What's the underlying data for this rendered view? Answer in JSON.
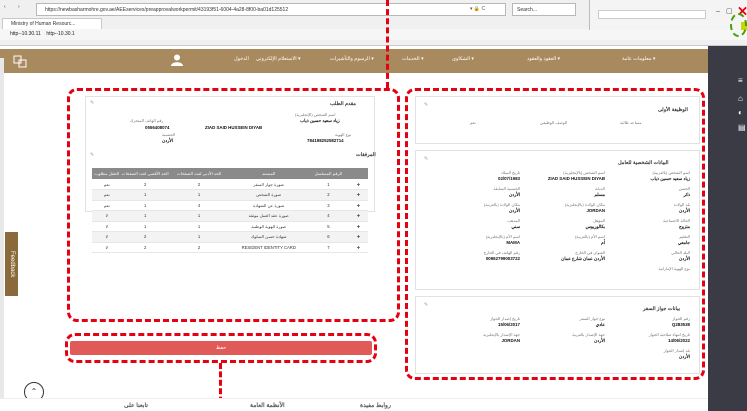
{
  "browser": {
    "url": "https://newbasharmohre.gov.ae/AEEservices/preapprovalworkpermit/43193f51-6004-4a28-8f00-ba01d125512",
    "lock_and_refresh": "▾ 🔒 C",
    "search_placeholder": "Search...",
    "tab_title": "Ministry of Human Resourc...",
    "favorites": [
      "http--10.30.11",
      "http--10.30.1"
    ]
  },
  "app": {
    "nav": [
      "معلومات عامة ▾",
      "العقود والعقود ▾",
      "الشكاوى ▾",
      "الخدمات ▾",
      "الرسوم والتأشيرات ▾",
      "الاستعلام الإلكتروني ▾",
      "الدخول"
    ]
  },
  "request_info": {
    "title": "مقدم الطلب",
    "name_label": "اسم الشخص (الإنجليزية)",
    "name_ar": "زياد سعيد حسين ذياب",
    "name_en": "ZIAD SAID HUSSEIN DIYAB",
    "phone_label": "رقم الهاتف المتحرك",
    "phone": "0556408074",
    "nationality_label": "الجنسية",
    "nationality": "الأردن",
    "id_type_label": "نوع الهوية",
    "id_number": "784198252582714"
  },
  "attachments": {
    "title": "المرفقات",
    "headers": [
      "الرقم المسلسل",
      "المستند",
      "الحد الأدنى لعدد الصفحات",
      "الحد الأقصى لعدد الصفحات",
      "الحقل مطلوب"
    ],
    "rows": [
      [
        "1",
        "صورة جواز السفر",
        "2",
        "2",
        "نعم"
      ],
      [
        "2",
        "صورة الشخص",
        "1",
        "1",
        "نعم"
      ],
      [
        "3",
        "صورة عن الشهادة",
        "4",
        "1",
        "نعم"
      ],
      [
        "4",
        "صورة عقد العمل موثقة",
        "1",
        "1",
        "لا"
      ],
      [
        "5",
        "صورة الهوية الوطنية",
        "1",
        "1",
        "لا"
      ],
      [
        "6",
        "شهادة حسن السلوك",
        "1",
        "2",
        "لا"
      ],
      [
        "7",
        "RESIDENT IDENTITY CARD",
        "2",
        "2",
        "لا"
      ]
    ]
  },
  "submit_label": "حفظ",
  "job_info": {
    "title": "الوظيفة الأولى",
    "left": "مساعد طالبة",
    "center": "الوصف الوظيفي",
    "right": "نعم"
  },
  "personal": {
    "title": "البيانات الشخصية للعامل",
    "fields": [
      {
        "label": "اسم الشخص (بالعربية)",
        "value": "زياد سعيد حسين ذياب"
      },
      {
        "label": "اسم الشخص (بالإنجليزية)",
        "value": "ZIAD SAID HUSSEIN DIYAB"
      },
      {
        "label": "تاريخ الميلاد",
        "value": "02/07/1983"
      },
      {
        "label": "الجنس",
        "value": "ذكر"
      },
      {
        "label": "الديانة",
        "value": "مسلم"
      },
      {
        "label": "الجنسية السابقة",
        "value": "الأردن"
      },
      {
        "label": "بلد الولادة",
        "value": "الأردن"
      },
      {
        "label": "مكان الولادة (بالإنجليزية)",
        "value": "JORDAN"
      },
      {
        "label": "مكان الولادة (بالعربية)",
        "value": "الأردن"
      },
      {
        "label": "الحالة الاجتماعية",
        "value": "متزوج"
      },
      {
        "label": "المؤهل",
        "value": "بكالوريوس"
      },
      {
        "label": "المذهب",
        "value": "سني"
      },
      {
        "label": "التعليم",
        "value": "جامعي"
      },
      {
        "label": "اسم الأم (بالعربية)",
        "value": "أم"
      },
      {
        "label": "اسم الأم (بالإنجليزية)",
        "value": "MAMA"
      },
      {
        "label": "البلد الحالي",
        "value": "الأردن"
      },
      {
        "label": "العنوان في الخارج",
        "value": "الأردن عمان شارع عمان"
      },
      {
        "label": "رقم الهاتف في الخارج",
        "value": "00962799003722"
      },
      {
        "label": "نوع الهوية الإماراتية",
        "value": ""
      }
    ]
  },
  "passport": {
    "title": "بيانات جواز السفر",
    "fields": [
      {
        "label": "رقم الجواز",
        "value": "Q283538"
      },
      {
        "label": "نوع جواز السفر",
        "value": "عادي"
      },
      {
        "label": "تاريخ إصدار الجواز",
        "value": "15/06/2017"
      },
      {
        "label": "تاريخ انتهاء صلاحية الجواز",
        "value": "14/06/2022"
      },
      {
        "label": "جهة الإصدار بالعربية",
        "value": "الأردن"
      },
      {
        "label": "جهة الإصدار بالإنجليزية",
        "value": "JORDAN"
      },
      {
        "label": "بلد إصدار الجواز",
        "value": "الأردن"
      }
    ]
  },
  "feedback_label": "Feedback",
  "footer": [
    "تابعنا على",
    "روابط مفيدة",
    "الأنظمة العامة"
  ]
}
